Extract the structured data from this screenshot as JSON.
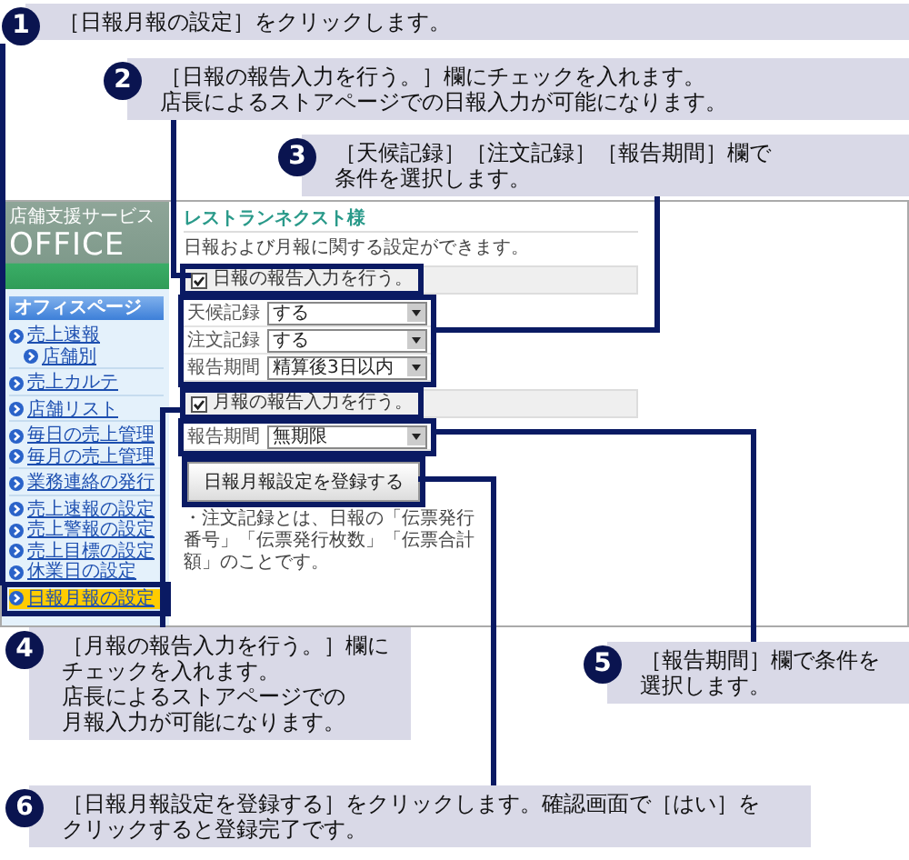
{
  "callouts": [
    {
      "number": "1",
      "lines": [
        "［日報月報の設定］をクリックします。"
      ]
    },
    {
      "number": "2",
      "lines": [
        "［日報の報告入力を行う。］欄にチェックを入れます。",
        "店長によるストアページでの日報入力が可能になります。"
      ]
    },
    {
      "number": "3",
      "lines": [
        "［天候記録］［注文記録］［報告期間］欄で",
        "条件を選択します。"
      ]
    },
    {
      "number": "4",
      "lines": [
        "［月報の報告入力を行う。］欄に",
        "チェックを入れます。",
        "店長によるストアページでの",
        "月報入力が可能になります。"
      ]
    },
    {
      "number": "5",
      "lines": [
        "［報告期間］欄で条件を",
        "選択します。"
      ]
    },
    {
      "number": "6",
      "lines": [
        "［日報月報設定を登録する］をクリックします。確認画面で［はい］を",
        "クリックすると登録完了です。"
      ]
    }
  ],
  "screen": {
    "brand": "店舗支援サービス",
    "logo": "OFFICE",
    "sidebar": {
      "header": "オフィスページ",
      "groups": [
        [
          {
            "label": "売上速報",
            "selected": false,
            "children": [
              {
                "label": "店舗別",
                "selected": false
              }
            ]
          }
        ],
        [
          {
            "label": "売上カルテ",
            "selected": false
          }
        ],
        [
          {
            "label": "店舗リスト",
            "selected": false
          }
        ],
        [
          {
            "label": "毎日の売上管理",
            "selected": false
          },
          {
            "label": "毎月の売上管理",
            "selected": false
          }
        ],
        [
          {
            "label": "業務連絡の発行",
            "selected": false
          }
        ],
        [
          {
            "label": "売上速報の設定",
            "selected": false
          },
          {
            "label": "売上警報の設定",
            "selected": false
          },
          {
            "label": "売上目標の設定",
            "selected": false
          },
          {
            "label": "休業日の設定",
            "selected": false
          }
        ],
        [
          {
            "label": "日報月報の設定",
            "selected": true
          }
        ]
      ]
    },
    "main": {
      "title": "レストランネクスト様",
      "description": "日報および月報に関する設定ができます。",
      "sections": [
        {
          "checkbox": {
            "label": "日報の報告入力を行う。",
            "checked": true
          },
          "fields": [
            {
              "label": "天候記録",
              "value": "する"
            },
            {
              "label": "注文記録",
              "value": "する"
            },
            {
              "label": "報告期間",
              "value": "精算後3日以内"
            }
          ]
        },
        {
          "checkbox": {
            "label": "月報の報告入力を行う。",
            "checked": true
          },
          "fields": [
            {
              "label": "報告期間",
              "value": "無期限"
            }
          ]
        }
      ],
      "submit_button": "日報月報設定を登録する",
      "note": "・注文記録とは、日報の「伝票発行番号」「伝票発行枚数」「伝票合計額」のことです。"
    }
  }
}
